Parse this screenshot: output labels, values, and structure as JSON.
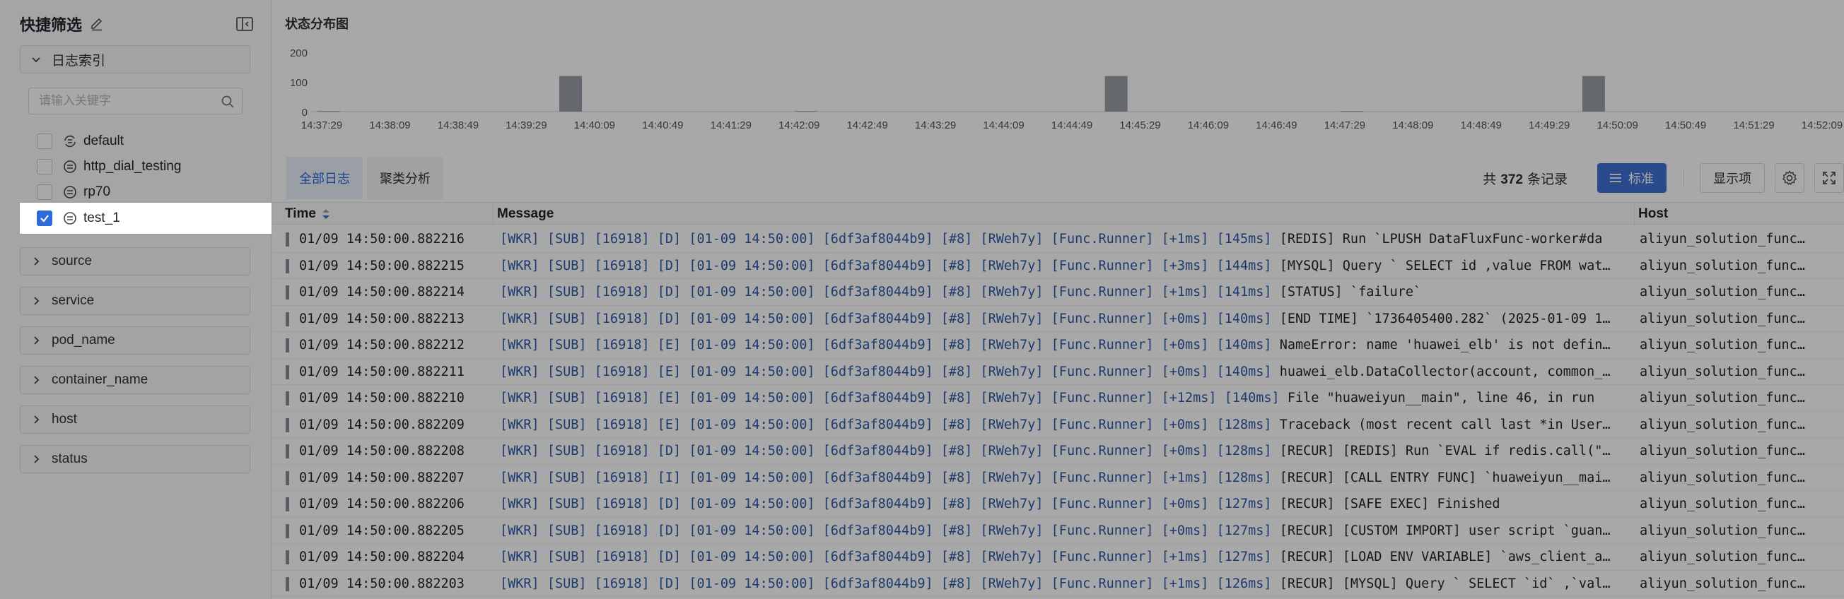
{
  "sidebar": {
    "title": "快捷筛选",
    "groups": [
      {
        "label": "日志索引",
        "expanded": true
      },
      {
        "label": "source"
      },
      {
        "label": "service"
      },
      {
        "label": "pod_name"
      },
      {
        "label": "container_name"
      },
      {
        "label": "host"
      },
      {
        "label": "status"
      }
    ],
    "search_placeholder": "请输入关键字",
    "indexes": [
      {
        "label": "default",
        "checked": false
      },
      {
        "label": "http_dial_testing",
        "checked": false
      },
      {
        "label": "rp70",
        "checked": false
      },
      {
        "label": "test_1",
        "checked": true
      }
    ]
  },
  "distribution": {
    "title": "状态分布图",
    "chart_data": {
      "type": "bar",
      "y_ticks": [
        "200",
        "100",
        "0"
      ],
      "ylim": [
        0,
        200
      ],
      "x_ticks": [
        "14:37:29",
        "14:38:09",
        "14:38:49",
        "14:39:29",
        "14:40:09",
        "14:40:49",
        "14:41:29",
        "14:42:09",
        "14:42:49",
        "14:43:29",
        "14:44:09",
        "14:44:49",
        "14:45:29",
        "14:46:09",
        "14:46:49",
        "14:47:29",
        "14:48:09",
        "14:48:49",
        "14:49:29",
        "14:50:09",
        "14:50:49",
        "14:51:29",
        "14:52:09"
      ],
      "bars": [
        {
          "x": "14:37:29",
          "value": 2
        },
        {
          "x": "14:39:29",
          "value": 120
        },
        {
          "x": "14:42:09",
          "value": 2
        },
        {
          "x": "14:44:49",
          "value": 120
        },
        {
          "x": "14:47:29",
          "value": 2
        },
        {
          "x": "14:49:29",
          "value": 120
        }
      ],
      "color": "#9aa0a8"
    }
  },
  "tabs": [
    "全部日志",
    "聚类分析"
  ],
  "toolbar": {
    "count_prefix": "共",
    "count": "372",
    "count_suffix": "条记录",
    "standard_label": "标准",
    "display_label": "显示项"
  },
  "table": {
    "columns": [
      "Time",
      "Message",
      "Host"
    ],
    "rows": [
      {
        "time": "01/09 14:50:00.882216",
        "level": "D",
        "dur": "[+1ms] [145ms]",
        "msg": "[REDIS] Run `LPUSH DataFluxFunc-worker#da",
        "host": "aliyun_solution_func…"
      },
      {
        "time": "01/09 14:50:00.882215",
        "level": "D",
        "dur": "[+3ms] [144ms]",
        "msg": "[MYSQL] Query ` SELECT id ,value FROM wat…",
        "host": "aliyun_solution_func…"
      },
      {
        "time": "01/09 14:50:00.882214",
        "level": "D",
        "dur": "[+1ms] [141ms]",
        "msg": "[STATUS] `failure`",
        "host": "aliyun_solution_func…"
      },
      {
        "time": "01/09 14:50:00.882213",
        "level": "D",
        "dur": "[+0ms] [140ms]",
        "msg": "[END TIME] `1736405400.282` (2025-01-09 1…",
        "host": "aliyun_solution_func…"
      },
      {
        "time": "01/09 14:50:00.882212",
        "level": "E",
        "dur": "[+0ms] [140ms]",
        "msg": "NameError: name 'huawei_elb' is not defin…",
        "host": "aliyun_solution_func…"
      },
      {
        "time": "01/09 14:50:00.882211",
        "level": "E",
        "dur": "[+0ms] [140ms]",
        "msg": "huawei_elb.DataCollector(account, common_…",
        "host": "aliyun_solution_func…"
      },
      {
        "time": "01/09 14:50:00.882210",
        "level": "E",
        "dur": "[+12ms] [140ms]",
        "msg": "File \"huaweiyun__main\", line 46, in run",
        "host": "aliyun_solution_func…"
      },
      {
        "time": "01/09 14:50:00.882209",
        "level": "E",
        "dur": "[+0ms] [128ms]",
        "msg": "Traceback (most recent call last *in User…",
        "host": "aliyun_solution_func…"
      },
      {
        "time": "01/09 14:50:00.882208",
        "level": "D",
        "dur": "[+0ms] [128ms]",
        "msg": "[RECUR] [REDIS] Run `EVAL if redis.call(\"…",
        "host": "aliyun_solution_func…"
      },
      {
        "time": "01/09 14:50:00.882207",
        "level": "I",
        "dur": "[+1ms] [128ms]",
        "msg": "[RECUR] [CALL ENTRY FUNC] `huaweiyun__mai…",
        "host": "aliyun_solution_func…"
      },
      {
        "time": "01/09 14:50:00.882206",
        "level": "D",
        "dur": "[+0ms] [127ms]",
        "msg": "[RECUR] [SAFE EXEC] Finished",
        "host": "aliyun_solution_func…"
      },
      {
        "time": "01/09 14:50:00.882205",
        "level": "D",
        "dur": "[+0ms] [127ms]",
        "msg": "[RECUR] [CUSTOM IMPORT] user script `guan…",
        "host": "aliyun_solution_func…"
      },
      {
        "time": "01/09 14:50:00.882204",
        "level": "D",
        "dur": "[+1ms] [127ms]",
        "msg": "[RECUR] [LOAD ENV VARIABLE] `aws_client_a…",
        "host": "aliyun_solution_func…"
      },
      {
        "time": "01/09 14:50:00.882203",
        "level": "D",
        "dur": "[+1ms] [126ms]",
        "msg": "[RECUR] [MYSQL] Query ` SELECT `id` ,`val…",
        "host": "aliyun_solution_func…"
      }
    ],
    "prefix_a": "[WKR] [SUB] [16918]",
    "prefix_b": "[01-09 14:50:00] [6df3af8044b9] [#8] [RWeh7y] [Func.Runner]"
  },
  "colors": {
    "accent": "#3f73d6",
    "overlay": "rgba(0,0,0,0.34)"
  }
}
